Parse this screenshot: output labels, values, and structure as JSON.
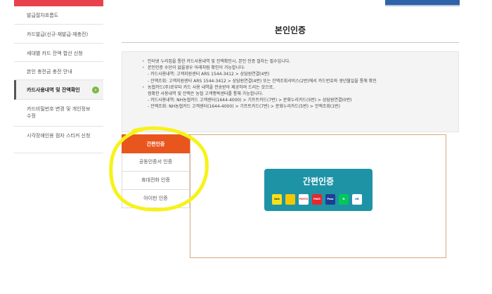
{
  "sidebar": {
    "items": [
      {
        "label": "발급절차흐름도"
      },
      {
        "label": "카드발급(신규·재발급·재충전)"
      },
      {
        "label": "세대별 카드 잔액 합산 신청"
      },
      {
        "label": "본인 충전금 충전 안내"
      },
      {
        "label": "카드사용내역 및 잔액확인",
        "active": true
      },
      {
        "label": "카드비밀번호 변경 및 개인정보수정"
      },
      {
        "label": "시각장애인용 점자 스티커 신청"
      }
    ],
    "active_icon": "chevron-right-icon",
    "accent_color": "#e8414b"
  },
  "page": {
    "title": "본인인증"
  },
  "notice": {
    "lines": [
      {
        "text": "인터넷 누리집을 통한 카드사용내역 및 잔액확인시, 본인 인증 절차는 필수입니다.",
        "bullet": true
      },
      {
        "text": "본인인증 수단이 없을경우 아래처럼 확인이 가능합니다:",
        "bullet": true
      },
      {
        "text": "- 카드사용내역: 고객지원센터 ARS 1544-3412 > 상담원연결(4번)",
        "bullet": false
      },
      {
        "text": "- 잔액조회: 고객지원센터 ARS 1544-3412 > 상담원연결(4번) 또는 잔액조회서비스(2번)에서 카드번호와 생년월일을 통해 확인",
        "bullet": false
      },
      {
        "text": "농협카드(주)로부터 카드 사용 내역을 전송받아 제공하여 드리는 것으로,",
        "bullet": true
      },
      {
        "text": "정확한 사용내역 및 잔액은 농협 고객행복센터를 통해 가능합니다.",
        "bullet": false
      },
      {
        "text": "- 카드사용내역: NH농협카드 고객센터(1644-4000) > 기프트카드(7번) > 문화누리카드(5번) > 상담원연결(0번)",
        "bullet": false
      },
      {
        "text": "- 잔액조회: NH농협카드 고객센터(1644-4000) > 기프트카드(7번) > 문화누리카드(5번) > 잔액조회(1번)",
        "bullet": false
      }
    ]
  },
  "auth": {
    "tabs": [
      {
        "label": "간편인증",
        "active": true
      },
      {
        "label": "공동인증서 인증"
      },
      {
        "label": "휴대전화 인증"
      },
      {
        "label": "아이핀 인증"
      }
    ],
    "simple_auth_label": "간편인증",
    "simple_auth_color": "#1f93a6",
    "active_tab_color": "#e8561e",
    "providers": [
      {
        "name": "kakao-icon",
        "text": "talk",
        "bg": "#f7e01c",
        "fg": "#3a1d1d"
      },
      {
        "name": "toss-icon",
        "text": "",
        "bg": "#f3c800",
        "fg": "#222222"
      },
      {
        "name": "payco-icon",
        "text": "PAYCO",
        "bg": "#ffffff",
        "fg": "#e8262d"
      },
      {
        "name": "pass-icon",
        "text": "PASS",
        "bg": "#e8262d",
        "fg": "#ffffff"
      },
      {
        "name": "samsungpass-icon",
        "text": "Pass",
        "bg": "#1c3f94",
        "fg": "#ffffff"
      },
      {
        "name": "naver-icon",
        "text": "N",
        "bg": "#03c75a",
        "fg": "#ffffff"
      },
      {
        "name": "kb-icon",
        "text": "KB",
        "bg": "#ffffff",
        "fg": "#1c5dbb"
      }
    ]
  },
  "annotation": {
    "color": "#f7f21a"
  }
}
